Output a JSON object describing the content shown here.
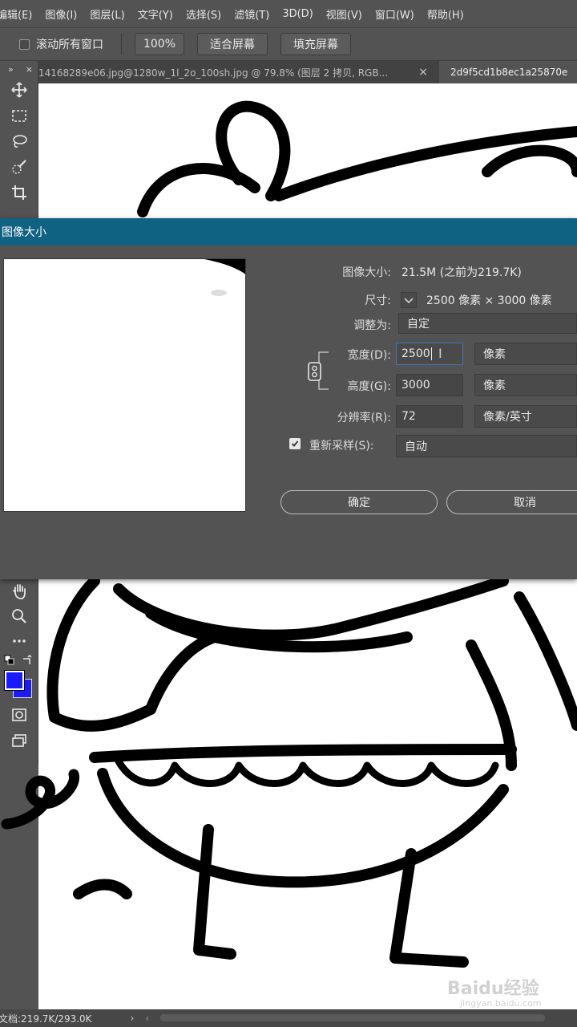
{
  "menubar": {
    "items": [
      "编辑(E)",
      "图像(I)",
      "图层(L)",
      "文字(Y)",
      "选择(S)",
      "滤镜(T)",
      "3D(D)",
      "视图(V)",
      "窗口(W)",
      "帮助(H)"
    ]
  },
  "options": {
    "scroll_all_label": "滚动所有窗口",
    "zoom_label": "100%",
    "fit_screen_label": "适合屏幕",
    "fill_screen_label": "填充屏幕"
  },
  "toolbar": {
    "expand": "»",
    "close": "×"
  },
  "tabs": [
    {
      "label": "14168289e06.jpg@1280w_1l_2o_100sh.jpg @ 79.8% (图层 2 拷贝, RGB...",
      "close": "×"
    },
    {
      "label": "2d9f5cd1b8ec1a25870e"
    }
  ],
  "dialog": {
    "title": "图像大小",
    "image_size_label": "图像大小:",
    "image_size_value": "21.5M (之前为219.7K)",
    "dimensions_label": "尺寸:",
    "dimensions_value": "2500 像素 × 3000 像素",
    "fit_to_label": "调整为:",
    "fit_to_value": "自定",
    "width_label": "宽度(D):",
    "width_value": "2500",
    "width_unit": "像素",
    "height_label": "高度(G):",
    "height_value": "3000",
    "height_unit": "像素",
    "resolution_label": "分辨率(R):",
    "resolution_value": "72",
    "resolution_unit": "像素/英寸",
    "resample_label": "重新采样(S):",
    "resample_value": "自动",
    "resample_checked": true,
    "ok_label": "确定",
    "cancel_label": "取消"
  },
  "status": {
    "doc_info": "文档:219.7K/293.0K",
    "arrow": "›",
    "arrow2": "‹"
  },
  "watermark": {
    "text": "Baidu经验",
    "sub": "jingyan.baidu.com"
  },
  "colors": {
    "foreground": "#1a1aff",
    "background": "#1a1aff",
    "dialog_title_bar": "#0f6281"
  }
}
